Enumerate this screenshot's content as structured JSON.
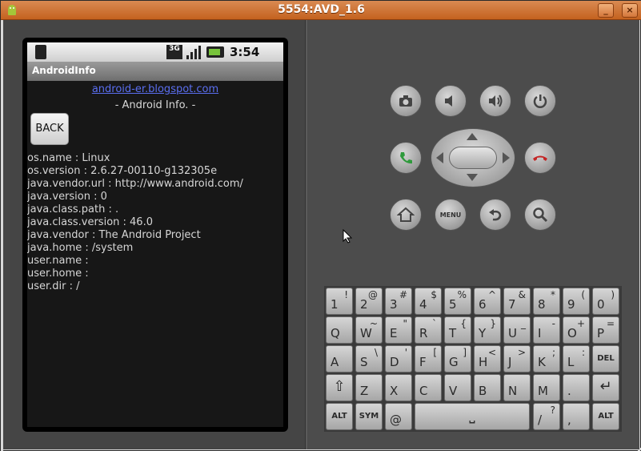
{
  "window": {
    "title": "5554:AVD_1.6"
  },
  "status_bar": {
    "network": "3G",
    "time": "3:54 AM"
  },
  "app": {
    "title": "AndroidInfo",
    "link": "android-er.blogspot.com",
    "subtitle": "- Android Info. -",
    "back_label": "BACK",
    "properties": [
      "os.name : Linux",
      "os.version : 2.6.27-00110-g132305e",
      "java.vendor.url : http://www.android.com/",
      "java.version : 0",
      "java.class.path : .",
      "java.class.version : 46.0",
      "java.vendor : The Android Project",
      "java.home : /system",
      "user.name :",
      "user.home :",
      "user.dir : /"
    ]
  },
  "hardware": {
    "menu_label": "MENU"
  },
  "keyboard": {
    "rows": [
      [
        [
          "1",
          "!"
        ],
        [
          "2",
          "@"
        ],
        [
          "3",
          "#"
        ],
        [
          "4",
          "$"
        ],
        [
          "5",
          "%"
        ],
        [
          "6",
          "^"
        ],
        [
          "7",
          "&"
        ],
        [
          "8",
          "*"
        ],
        [
          "9",
          "("
        ],
        [
          "0",
          ")"
        ]
      ],
      [
        [
          "Q",
          ""
        ],
        [
          "W",
          "~"
        ],
        [
          "E",
          "\""
        ],
        [
          "R",
          "`"
        ],
        [
          "T",
          "{"
        ],
        [
          "Y",
          "}"
        ],
        [
          "U",
          "_"
        ],
        [
          "I",
          "-"
        ],
        [
          "O",
          "+"
        ],
        [
          "P",
          "="
        ]
      ],
      [
        [
          "A",
          ""
        ],
        [
          "S",
          "\\"
        ],
        [
          "D",
          "'"
        ],
        [
          "F",
          "["
        ],
        [
          "G",
          "]"
        ],
        [
          "H",
          "<"
        ],
        [
          "J",
          ">"
        ],
        [
          "K",
          ";"
        ],
        [
          "L",
          ":"
        ],
        [
          "DEL",
          ""
        ]
      ],
      [
        [
          "",
          ""
        ],
        [
          "Z",
          ""
        ],
        [
          "X",
          ""
        ],
        [
          "C",
          ""
        ],
        [
          "V",
          ""
        ],
        [
          "B",
          ""
        ],
        [
          "N",
          ""
        ],
        [
          "M",
          ""
        ],
        [
          ".",
          ""
        ],
        [
          "",
          ""
        ]
      ],
      [
        [
          "ALT",
          ""
        ],
        [
          "SYM",
          ""
        ],
        [
          "@",
          ""
        ],
        [
          "",
          ""
        ],
        [
          "/",
          "?"
        ],
        [
          ",",
          ""
        ],
        [
          "ALT",
          ""
        ]
      ]
    ]
  },
  "colors": {
    "titlebar": "#c4621f",
    "link": "#5a6ef0",
    "call_green": "#2f9a3c",
    "end_red": "#c42424"
  }
}
